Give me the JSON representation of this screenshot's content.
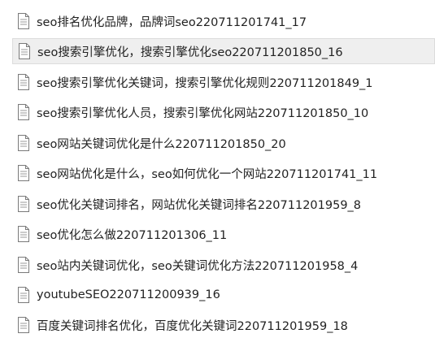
{
  "files": [
    {
      "name": "seo排名优化品牌，品牌词seo220711201741_17",
      "icon": "text-file-icon",
      "selected": false
    },
    {
      "name": "seo搜索引擎优化，搜索引擎优化seo220711201850_16",
      "icon": "text-file-icon",
      "selected": true
    },
    {
      "name": "seo搜索引擎优化关键词，搜索引擎优化规则220711201849_1",
      "icon": "text-file-icon",
      "selected": false
    },
    {
      "name": "seo搜索引擎优化人员，搜索引擎优化网站220711201850_10",
      "icon": "text-file-icon",
      "selected": false
    },
    {
      "name": "seo网站关键词优化是什么220711201850_20",
      "icon": "text-file-icon",
      "selected": false
    },
    {
      "name": "seo网站优化是什么，seo如何优化一个网站220711201741_11",
      "icon": "text-file-icon",
      "selected": false
    },
    {
      "name": "seo优化关键词排名，网站优化关键词排名220711201959_8",
      "icon": "text-file-icon",
      "selected": false
    },
    {
      "name": "seo优化怎么做220711201306_11",
      "icon": "text-file-icon",
      "selected": false
    },
    {
      "name": "seo站内关键词优化，seo关键词优化方法220711201958_4",
      "icon": "text-file-icon",
      "selected": false
    },
    {
      "name": "youtubeSEO220711200939_16",
      "icon": "text-file-icon",
      "selected": false
    },
    {
      "name": "百度关键词排名优化，百度优化关键词220711201959_18",
      "icon": "text-file-icon",
      "selected": false
    }
  ]
}
